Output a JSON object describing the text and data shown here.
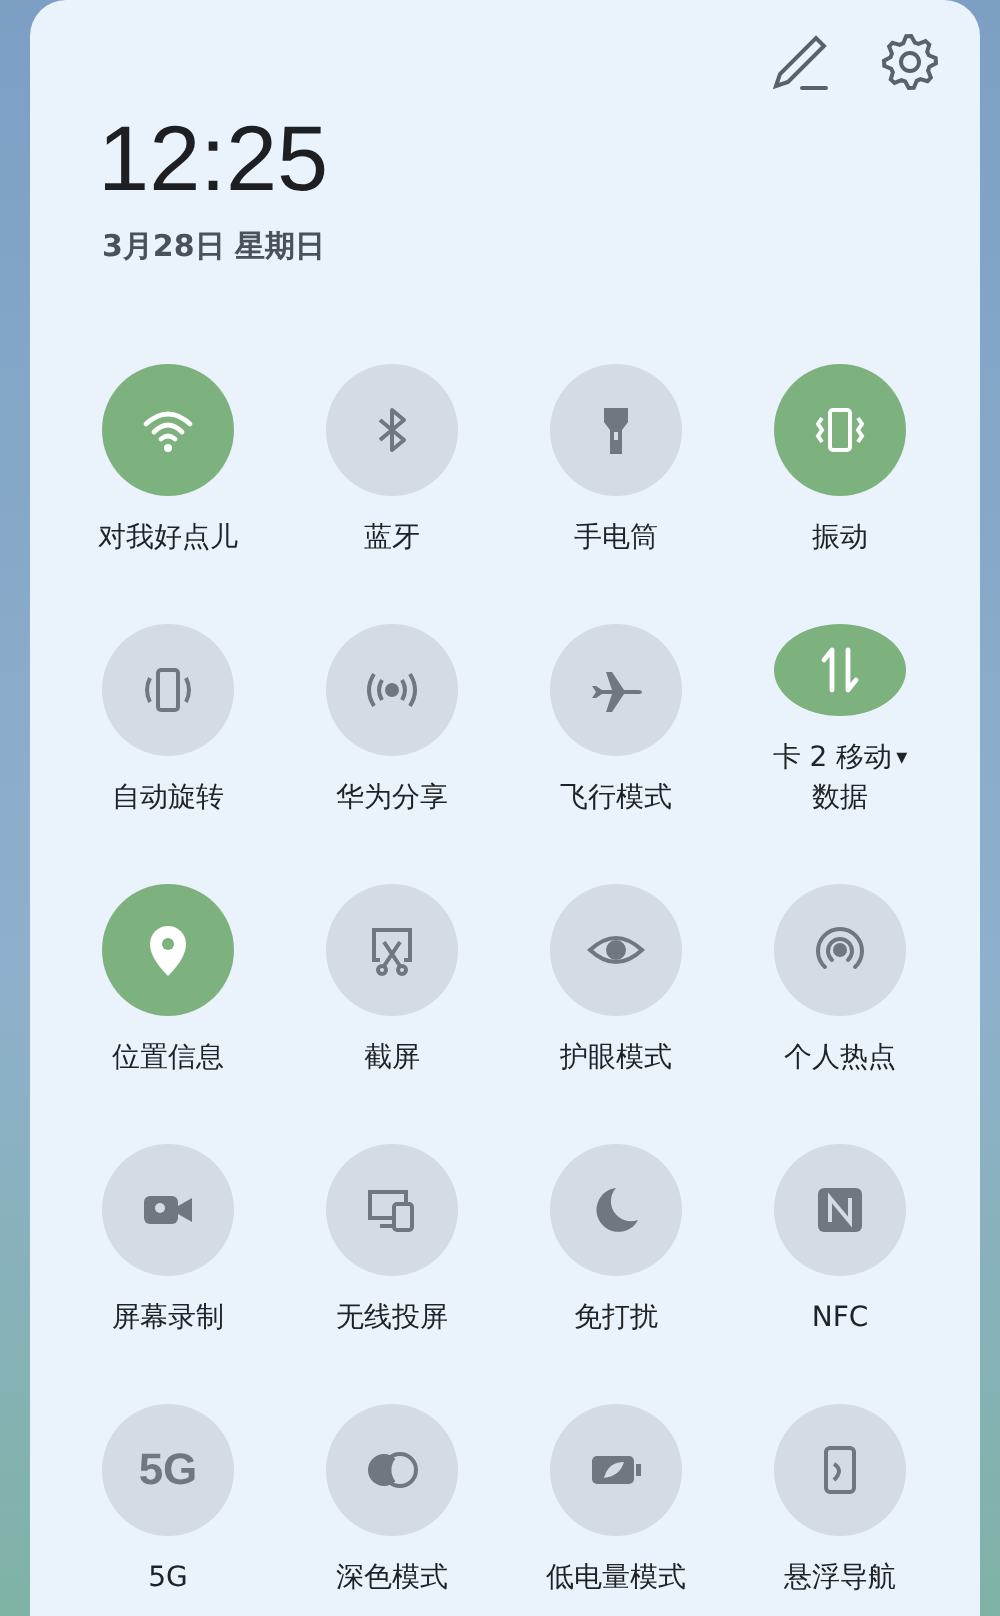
{
  "header": {
    "time": "12:25",
    "date": "3月28日 星期日"
  },
  "tiles": [
    {
      "label": "对我好点儿",
      "on": true
    },
    {
      "label": "蓝牙",
      "on": false
    },
    {
      "label": "手电筒",
      "on": false
    },
    {
      "label": "振动",
      "on": true
    },
    {
      "label": "自动旋转",
      "on": false
    },
    {
      "label": "华为分享",
      "on": false
    },
    {
      "label": "飞行模式",
      "on": false
    },
    {
      "label": "卡 2 移动",
      "dropdown": "▾",
      "sublabel": "数据",
      "on": true
    },
    {
      "label": "位置信息",
      "on": true
    },
    {
      "label": "截屏",
      "on": false
    },
    {
      "label": "护眼模式",
      "on": false
    },
    {
      "label": "个人热点",
      "on": false
    },
    {
      "label": "屏幕录制",
      "on": false
    },
    {
      "label": "无线投屏",
      "on": false
    },
    {
      "label": "免打扰",
      "on": false
    },
    {
      "label": "NFC",
      "on": false
    },
    {
      "label": "5G",
      "icon_text": "5G",
      "on": false
    },
    {
      "label": "深色模式",
      "on": false
    },
    {
      "label": "低电量模式",
      "on": false
    },
    {
      "label": "悬浮导航",
      "on": false
    }
  ]
}
